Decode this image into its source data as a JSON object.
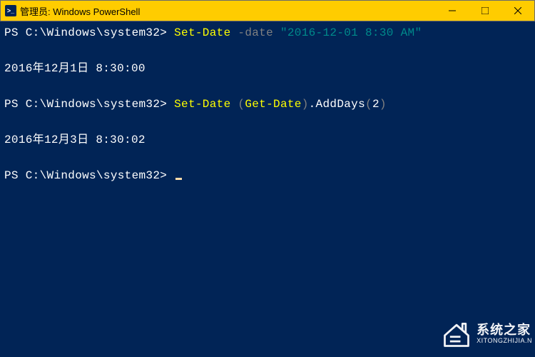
{
  "window": {
    "title": "管理员: Windows PowerShell"
  },
  "lines": {
    "l1_prompt": "PS C:\\Windows\\system32> ",
    "l1_cmdlet": "Set-Date",
    "l1_param": " -date ",
    "l1_string": "\"2016-12-01 8:30 AM\"",
    "l2_output": "2016年12月1日 8:30:00",
    "l3_prompt": "PS C:\\Windows\\system32> ",
    "l3_cmdlet": "Set-Date",
    "l3_space": " ",
    "l3_paren_open": "(",
    "l3_getdate": "Get-Date",
    "l3_paren_close": ")",
    "l3_method": ".AddDays",
    "l3_arg_open": "(",
    "l3_arg": "2",
    "l3_arg_close": ")",
    "l4_output": "2016年12月3日 8:30:02",
    "l5_prompt": "PS C:\\Windows\\system32> "
  },
  "watermark": {
    "title": "系统之家",
    "url": "XITONGZHIJIA.N"
  }
}
